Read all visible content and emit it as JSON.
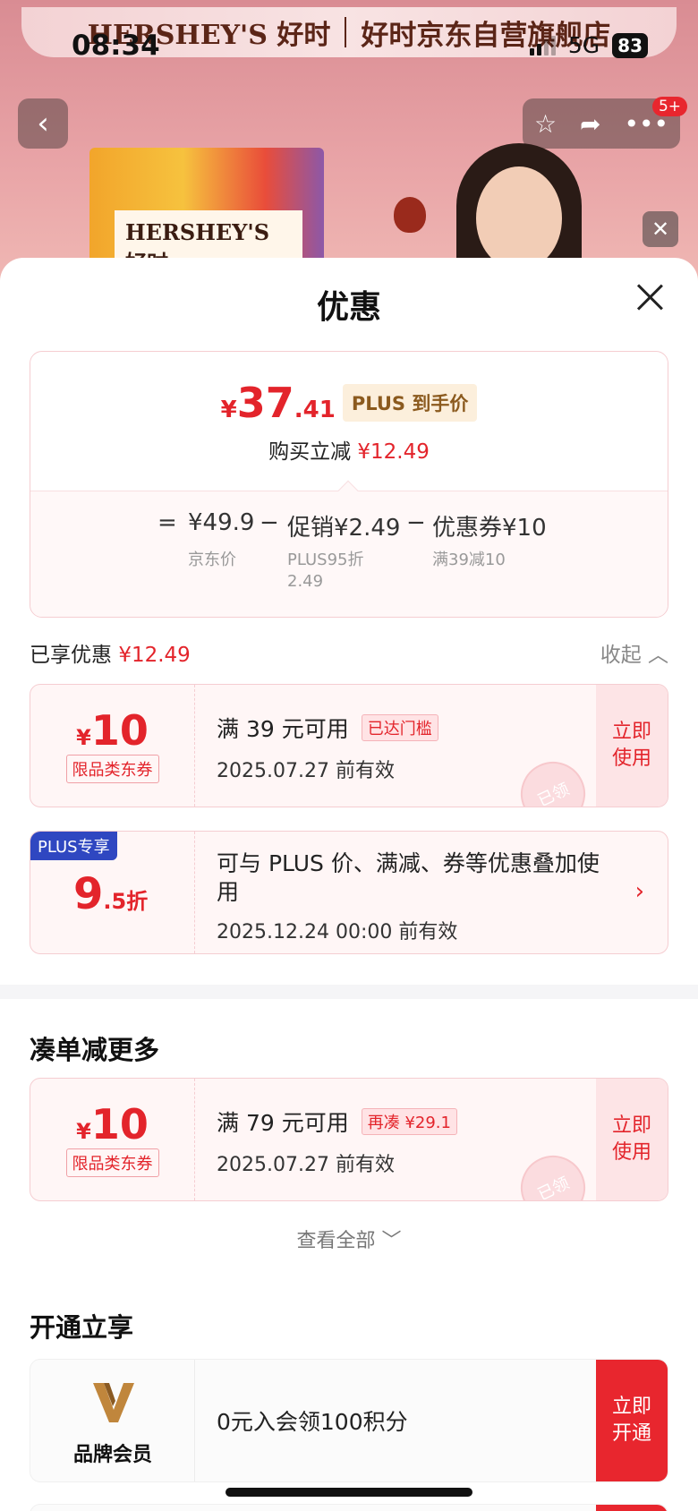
{
  "status_bar": {
    "time": "08:34",
    "network": "5G",
    "battery": "83"
  },
  "background": {
    "brand": "HERSHEY'S 好时",
    "store": "好时京东自营旗舰店",
    "product_label": "HERSHEY'S 好时",
    "notification_badge": "5+"
  },
  "sheet": {
    "title": "优惠"
  },
  "summary": {
    "price_symbol": "¥",
    "price_integer": "37",
    "price_decimal": ".41",
    "price_tag": "PLUS 到手价",
    "reduce_label": "购买立减",
    "reduce_amount": "¥12.49",
    "calc": {
      "eq": "=",
      "jd_price": "¥49.9",
      "jd_price_label": "京东价",
      "minus1": "−",
      "promo": "促销¥2.49",
      "promo_label_1": "PLUS95折",
      "promo_label_2": "2.49",
      "minus2": "−",
      "coupon": "优惠券¥10",
      "coupon_label": "满39减10"
    }
  },
  "enjoyed": {
    "label": "已享优惠",
    "amount": "¥12.49",
    "collapse": "收起"
  },
  "coupon1": {
    "symbol": "¥",
    "amount": "10",
    "type": "限品类东券",
    "condition": "满 39 元可用",
    "status": "已达门槛",
    "valid": "2025.07.27 前有效",
    "action": "立即使用",
    "stamp": "已领"
  },
  "plus_card": {
    "corner": "PLUS专享",
    "discount_int": "9",
    "discount_dec": ".5折",
    "desc": "可与 PLUS 价、满减、券等优惠叠加使用",
    "valid": "2025.12.24 00:00 前有效"
  },
  "more_section": {
    "title": "凑单减更多"
  },
  "coupon2": {
    "symbol": "¥",
    "amount": "10",
    "type": "限品类东券",
    "condition": "满 79 元可用",
    "status": "再凑 ¥29.1",
    "valid": "2025.07.27 前有效",
    "action": "立即使用",
    "stamp": "已领"
  },
  "view_all": "查看全部",
  "open_section": {
    "title": "开通立享"
  },
  "member": {
    "label": "品牌会员",
    "text": "0元入会领100积分",
    "action": "立即开通"
  },
  "colors": {
    "accent_red": "#e3242b",
    "plus_blue": "#2f47c1",
    "gold": "#8b5a1e"
  }
}
